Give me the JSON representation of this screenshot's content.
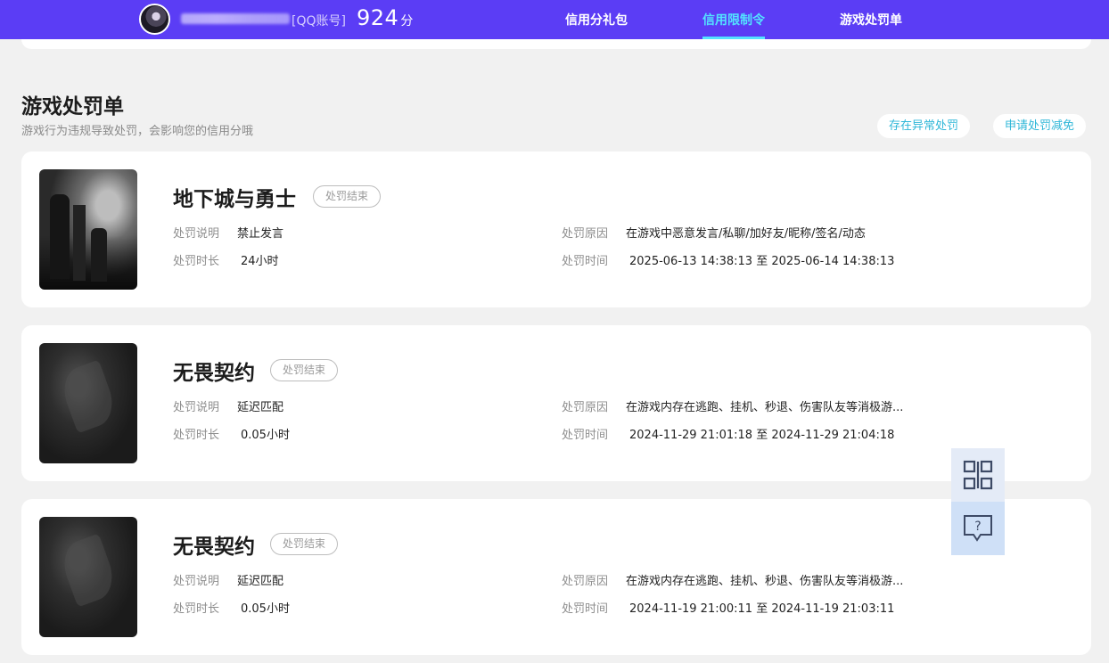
{
  "header": {
    "account_tag": "[QQ账号]",
    "score": "924",
    "score_unit": "分",
    "nav": [
      {
        "label": "信用分礼包",
        "active": false
      },
      {
        "label": "信用限制令",
        "active": true
      },
      {
        "label": "游戏处罚单",
        "active": false
      }
    ],
    "accent_color": "#5b3df5",
    "active_color": "#53e3ff"
  },
  "section": {
    "title": "游戏处罚单",
    "subtitle": "游戏行为违规导致处罚，会影响您的信用分哦",
    "actions": [
      "存在异常处罚",
      "申请处罚减免"
    ]
  },
  "labels": {
    "desc": "处罚说明",
    "duration": "处罚时长",
    "reason": "处罚原因",
    "time": "处罚时间"
  },
  "penalties": [
    {
      "game": "地下城与勇士",
      "status": "处罚结束",
      "desc": "禁止发言",
      "duration": "24小时",
      "reason": "在游戏中恶意发言/私聊/加好友/昵称/签名/动态",
      "time": "2025-06-13 14:38:13 至 2025-06-14 14:38:13"
    },
    {
      "game": "无畏契约",
      "status": "处罚结束",
      "desc": "延迟匹配",
      "duration": "0.05小时",
      "reason": "在游戏内存在逃跑、挂机、秒退、伤害队友等消极游...",
      "time": "2024-11-29 21:01:18 至 2024-11-29 21:04:18"
    },
    {
      "game": "无畏契约",
      "status": "处罚结束",
      "desc": "延迟匹配",
      "duration": "0.05小时",
      "reason": "在游戏内存在逃跑、挂机、秒退、伤害队友等消极游...",
      "time": "2024-11-19 21:00:11 至 2024-11-19 21:03:11"
    }
  ],
  "side_buttons": [
    "qrcode-icon",
    "help-chat-icon"
  ]
}
